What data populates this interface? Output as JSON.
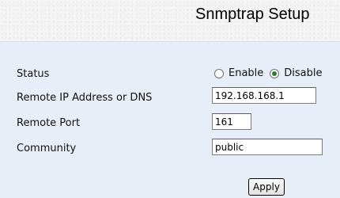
{
  "header": {
    "title": "Snmptrap Setup"
  },
  "form": {
    "status": {
      "label": "Status",
      "options": [
        {
          "label": "Enable",
          "selected": false
        },
        {
          "label": "Disable",
          "selected": true
        }
      ]
    },
    "remote_ip": {
      "label": "Remote IP Address or DNS",
      "value": "192.168.168.1"
    },
    "remote_port": {
      "label": "Remote Port",
      "value": "161"
    },
    "community": {
      "label": "Community",
      "value": "public"
    }
  },
  "actions": {
    "apply_label": "Apply"
  },
  "colors": {
    "panel_background": "#e7eef7",
    "header_background": "#f4f4f4"
  }
}
